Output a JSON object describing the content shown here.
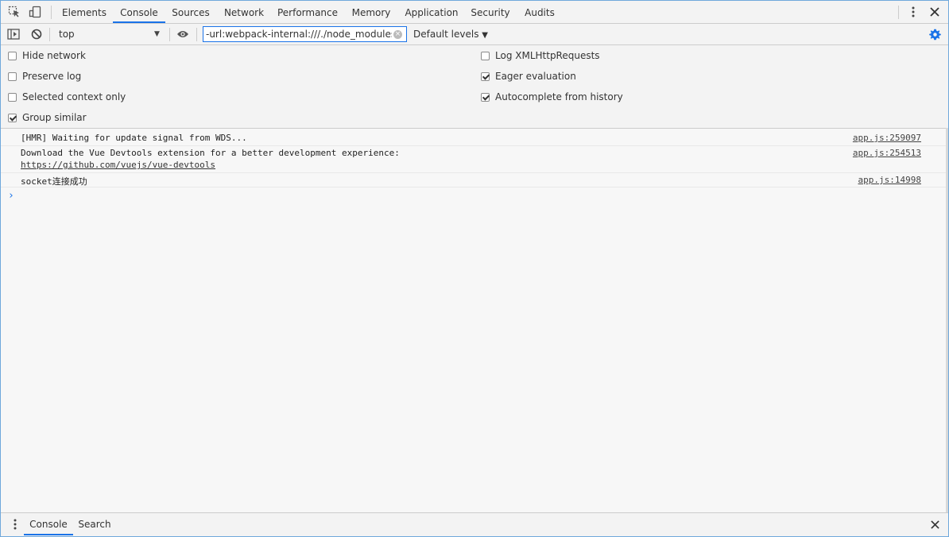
{
  "tabs": [
    {
      "label": "Elements",
      "active": false
    },
    {
      "label": "Console",
      "active": true
    },
    {
      "label": "Sources",
      "active": false
    },
    {
      "label": "Network",
      "active": false
    },
    {
      "label": "Performance",
      "active": false
    },
    {
      "label": "Memory",
      "active": false
    },
    {
      "label": "Application",
      "active": false
    },
    {
      "label": "Security",
      "active": false
    },
    {
      "label": "Audits",
      "active": false
    }
  ],
  "toolbar": {
    "context": "top",
    "filter_value": "-url:webpack-internal:///./node_modules/babel",
    "levels": "Default levels",
    "levels_arrow": "▼"
  },
  "settings": {
    "hide_network": {
      "label": "Hide network",
      "checked": false
    },
    "preserve_log": {
      "label": "Preserve log",
      "checked": false
    },
    "selected_context_only": {
      "label": "Selected context only",
      "checked": false
    },
    "group_similar": {
      "label": "Group similar",
      "checked": true
    },
    "log_xhr": {
      "label": "Log XMLHttpRequests",
      "checked": false
    },
    "eager_evaluation": {
      "label": "Eager evaluation",
      "checked": true
    },
    "autocomplete_history": {
      "label": "Autocomplete from history",
      "checked": true
    }
  },
  "messages": [
    {
      "text": "[HMR] Waiting for update signal from WDS...",
      "source": "app.js:259097"
    },
    {
      "text": "Download the Vue Devtools extension for a better development experience:",
      "link": "https://github.com/vuejs/vue-devtools",
      "source": "app.js:254513"
    },
    {
      "text": "socket连接成功",
      "source": "app.js:14998"
    }
  ],
  "prompt": "›",
  "drawer": {
    "tabs": [
      {
        "label": "Console",
        "active": true
      },
      {
        "label": "Search",
        "active": false
      }
    ]
  },
  "colors": {
    "accent": "#1a73e8",
    "panel_bg": "#f3f3f3",
    "console_bg": "#f7f7f7"
  }
}
